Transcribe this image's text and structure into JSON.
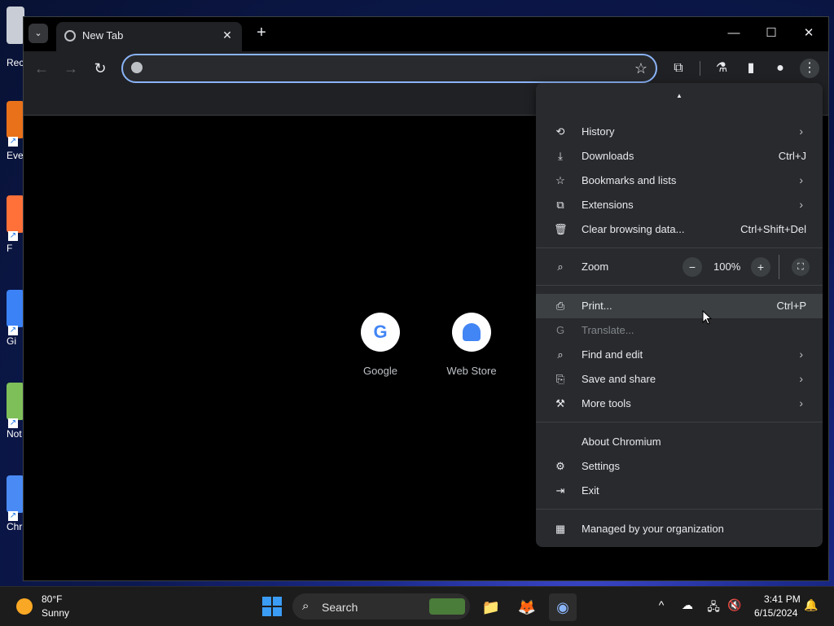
{
  "desktop": {
    "icons": [
      {
        "label": "Rec"
      },
      {
        "label": "Eve"
      },
      {
        "label": "F"
      },
      {
        "label": "Gi"
      },
      {
        "label": "Not"
      },
      {
        "label": "Chr"
      }
    ]
  },
  "browser": {
    "tab": {
      "title": "New Tab",
      "close": "✕"
    },
    "new_tab": "+",
    "window_controls": {
      "minimize": "—",
      "maximize": "☐",
      "close": "✕"
    },
    "toolbar": {
      "back": "←",
      "forward": "→",
      "reload": "↻",
      "omnibox_value": "",
      "omnibox_placeholder": "",
      "star": "☆",
      "extensions": "⧉",
      "labs": "⚗",
      "sidepanel": "▮",
      "profile": "●",
      "menu": "⋮"
    },
    "shortcuts": [
      {
        "label": "Google",
        "letter": "G"
      },
      {
        "label": "Web Store"
      }
    ]
  },
  "menu": {
    "items": [
      {
        "label": "History",
        "icon": "history-icon",
        "glyph": "⟲",
        "shortcut": "",
        "submenu": true
      },
      {
        "label": "Downloads",
        "icon": "download-icon",
        "glyph": "⤓",
        "shortcut": "Ctrl+J",
        "submenu": false
      },
      {
        "label": "Bookmarks and lists",
        "icon": "star-icon",
        "glyph": "☆",
        "shortcut": "",
        "submenu": true
      },
      {
        "label": "Extensions",
        "icon": "extension-icon",
        "glyph": "⧉",
        "shortcut": "",
        "submenu": true
      },
      {
        "label": "Clear browsing data...",
        "icon": "trash-icon",
        "glyph": "🗑",
        "shortcut": "Ctrl+Shift+Del",
        "submenu": false
      }
    ],
    "zoom": {
      "label": "Zoom",
      "value": "100%",
      "minus": "−",
      "plus": "+",
      "fullscreen": "⛶"
    },
    "items2": [
      {
        "label": "Print...",
        "shortcut": "Ctrl+P",
        "glyph": "⎙"
      },
      {
        "label": "Translate...",
        "glyph": "G"
      },
      {
        "label": "Find and edit",
        "glyph": "⌕"
      },
      {
        "label": "Save and share",
        "glyph": "⎘"
      },
      {
        "label": "More tools",
        "glyph": "⚒"
      }
    ],
    "about": "About Chromium",
    "settings": "Settings",
    "settings_glyph": "⚙",
    "exit": "Exit",
    "exit_glyph": "⇥",
    "managed": "Managed by your organization",
    "managed_glyph": "▦",
    "chevron": "›"
  },
  "taskbar": {
    "weather": {
      "temp": "80°F",
      "desc": "Sunny"
    },
    "search": {
      "label": "Search",
      "icon": "⌕"
    },
    "apps": {
      "explorer": "📁",
      "firefox": "🦊",
      "chromium": "◉"
    },
    "tray": {
      "chevron": "^",
      "cloud": "☁",
      "network": "🖧",
      "volume": "🔇",
      "bell": "🔔"
    },
    "clock": {
      "time": "3:41 PM",
      "date": "6/15/2024"
    }
  }
}
